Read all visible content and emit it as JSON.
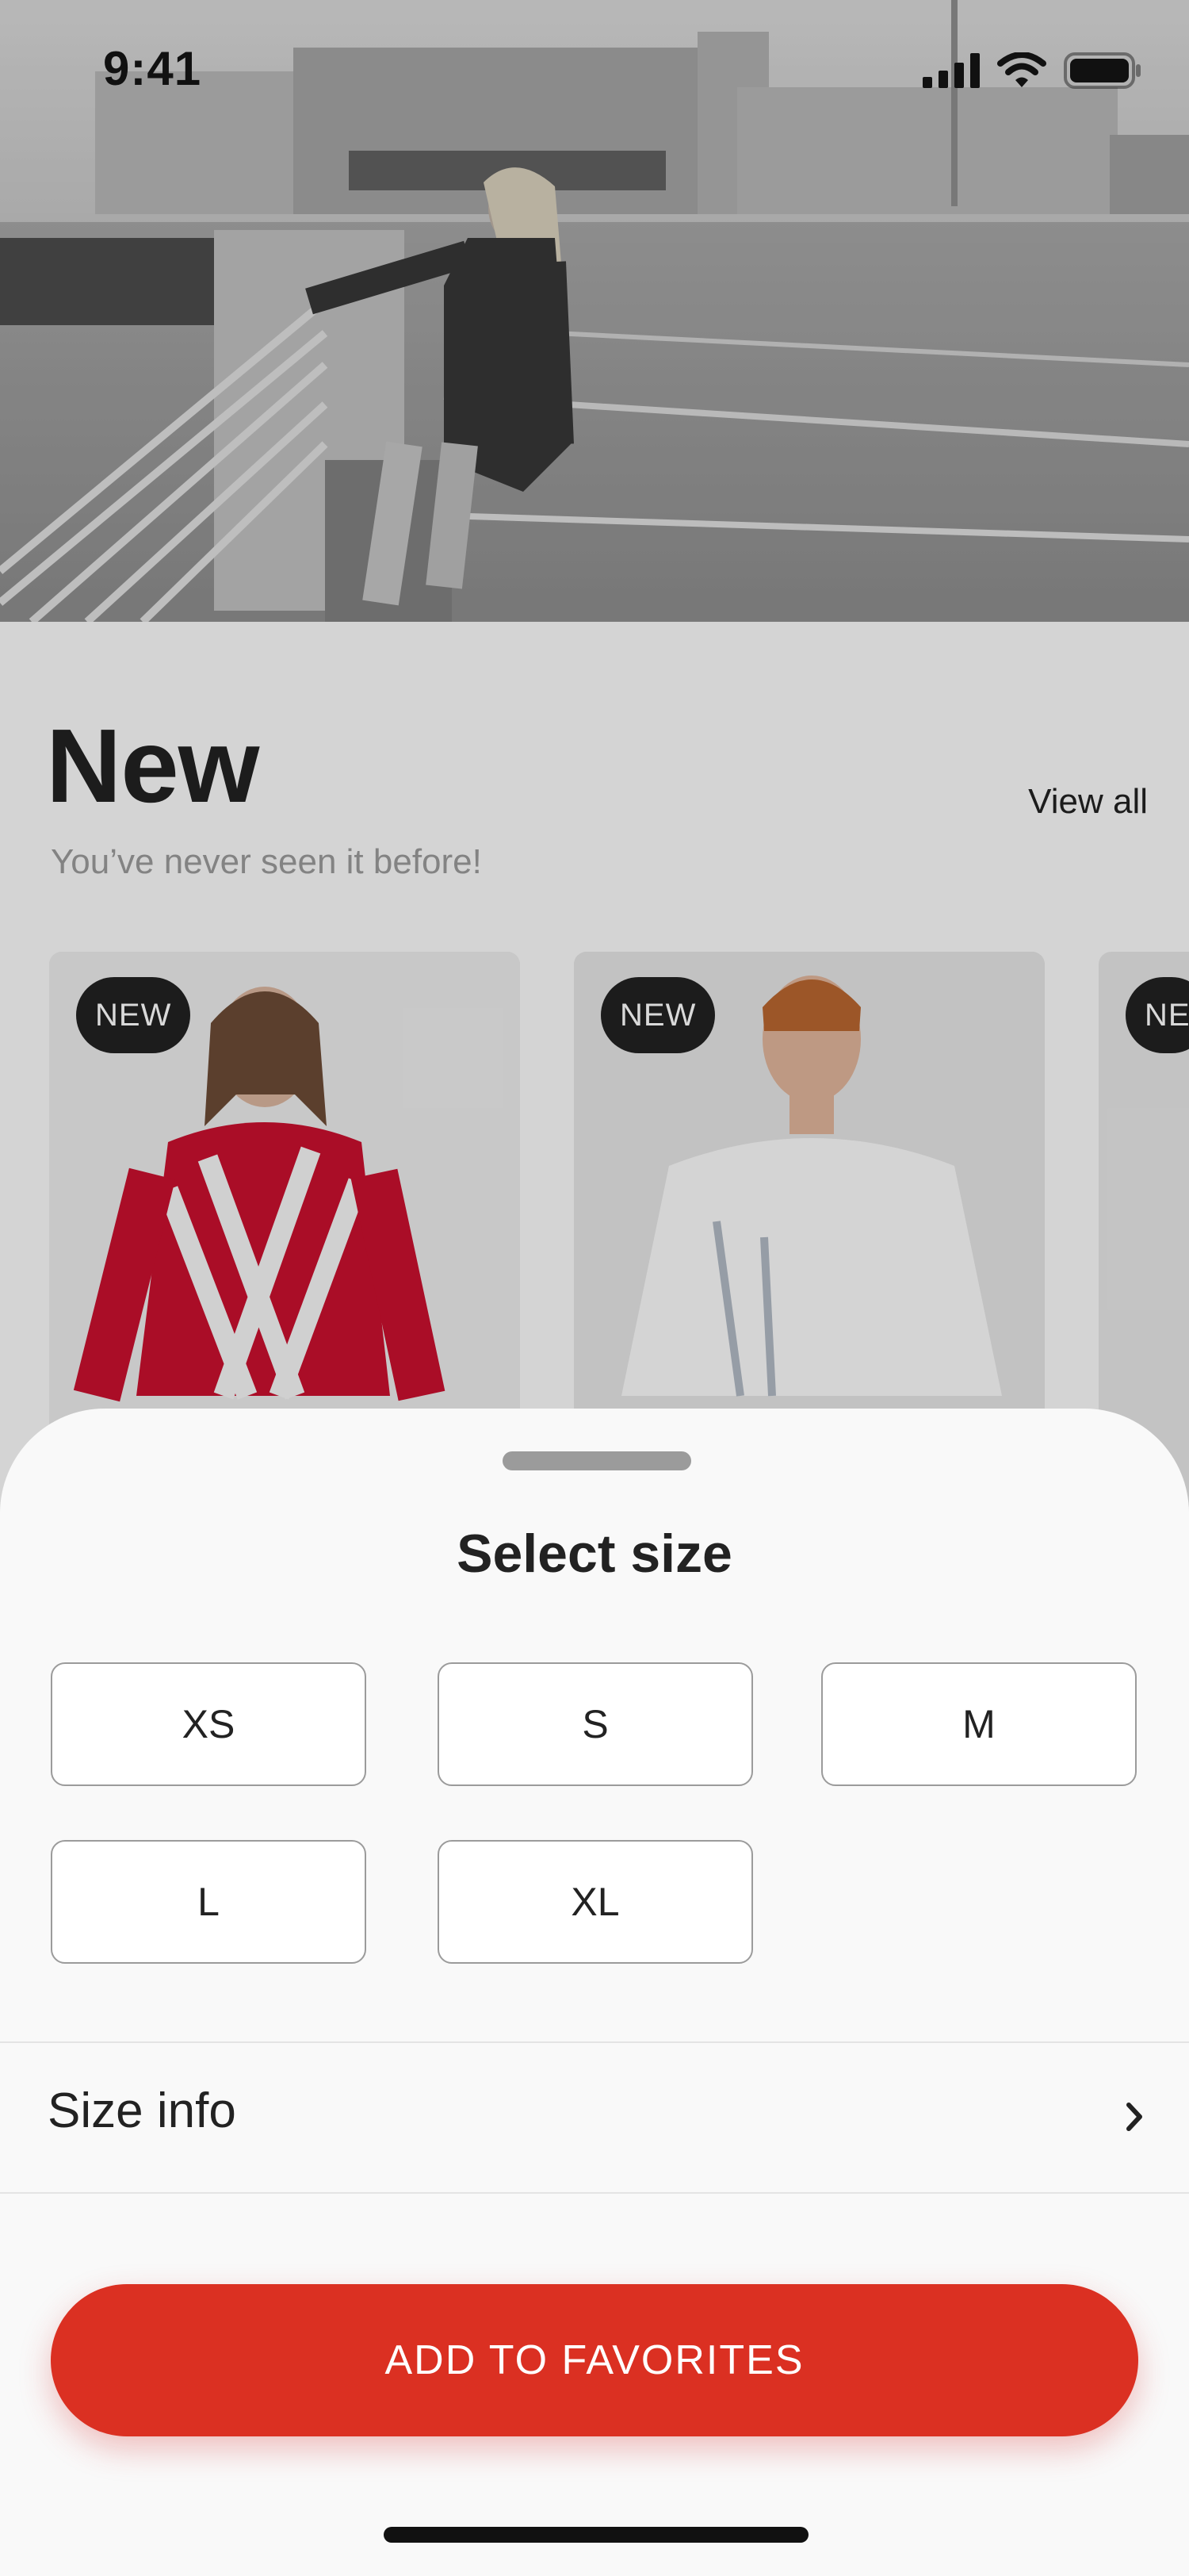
{
  "status_bar": {
    "time": "9:41",
    "icons": [
      "signal-icon",
      "wifi-icon",
      "battery-icon"
    ]
  },
  "section": {
    "title": "New",
    "subtitle": "You’ve never seen it before!",
    "view_all": "View all"
  },
  "products": [
    {
      "badge": "NEW"
    },
    {
      "badge": "NEW"
    },
    {
      "badge": "NE"
    }
  ],
  "sheet": {
    "title": "Select size",
    "sizes": [
      "XS",
      "S",
      "M",
      "L",
      "XL"
    ],
    "size_info": "Size info",
    "button_label": "ADD TO FAVORITES"
  },
  "colors": {
    "accent": "#DB3022",
    "text_primary": "#222222",
    "text_secondary": "#9B9B9B",
    "sheet_background": "#F9F9F9"
  }
}
